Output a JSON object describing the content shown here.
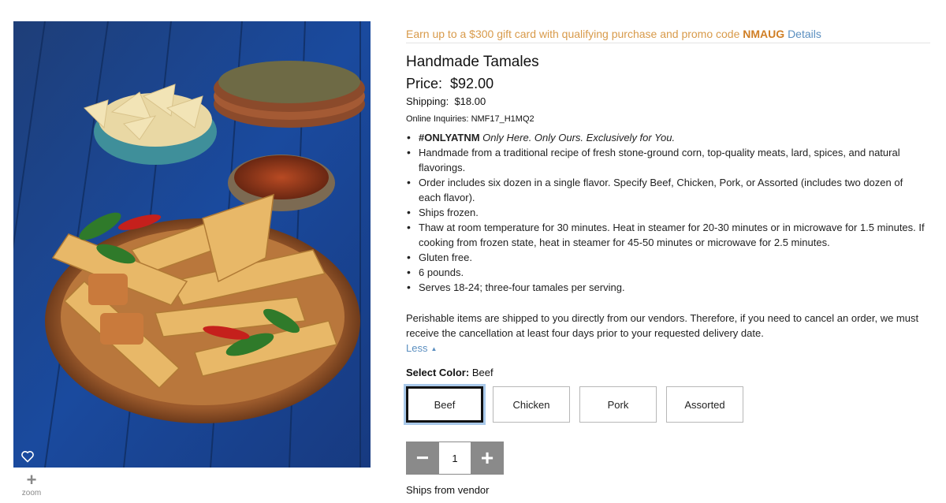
{
  "image": {
    "alt": "Handmade Tamales",
    "heart_icon": "heart-outline-icon",
    "zoom_icon": "plus-icon",
    "zoom_label": "zoom"
  },
  "promo": {
    "text": "Earn up to a $300 gift card with qualifying purchase and promo code ",
    "code": "NMAUG",
    "link": "Details"
  },
  "product": {
    "title": "Handmade Tamales",
    "price_label": "Price:",
    "price": "$92.00",
    "shipping_label": "Shipping:",
    "shipping": "$18.00",
    "inquiries_label": "Online Inquiries:",
    "inquiries": "NMF17_H1MQ2"
  },
  "bullets": {
    "onlyatnm_bold": "#ONLYATNM",
    "onlyatnm_italic": "Only Here. Only Ours. Exclusively for You.",
    "items": [
      "Handmade from a traditional recipe of fresh stone-ground corn, top-quality meats, lard, spices, and natural flavorings.",
      "Order includes six dozen in a single flavor. Specify Beef, Chicken, Pork, or Assorted (includes two dozen of each flavor).",
      "Ships frozen.",
      "Thaw at room temperature for 30 minutes. Heat in steamer for 20-30 minutes or in microwave for 1.5 minutes. If cooking from frozen state, heat in steamer for 45-50 minutes or microwave for 2.5 minutes.",
      "Gluten free.",
      "6 pounds.",
      "Serves 18-24; three-four tamales per serving."
    ]
  },
  "note": "Perishable items are shipped to you directly from our vendors. Therefore, if you need to cancel an order, we must receive the cancellation at least four days prior to your requested delivery date.",
  "less": {
    "label": "Less",
    "arrow": "▲"
  },
  "color_select": {
    "label": "Select Color:",
    "selected": "Beef",
    "options": [
      "Beef",
      "Chicken",
      "Pork",
      "Assorted"
    ]
  },
  "quantity": {
    "minus": "−",
    "value": "1",
    "plus": "+"
  },
  "ships_from": "Ships from vendor",
  "colors": {
    "promo": "#d89a4a",
    "link": "#5b8fc0",
    "selected_border": "#111111",
    "qty_button": "#8a8a8a"
  }
}
